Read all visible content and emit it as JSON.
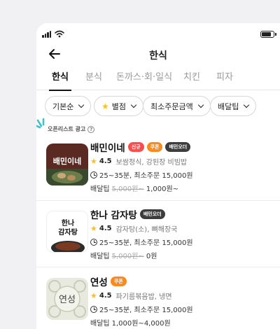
{
  "header": {
    "title": "한식"
  },
  "tabs": [
    {
      "label": "한식"
    },
    {
      "label": "분식"
    },
    {
      "label": "돈까스·회·일식"
    },
    {
      "label": "치킨"
    },
    {
      "label": "피자"
    }
  ],
  "filters": [
    {
      "label": "기본순"
    },
    {
      "label": "별점"
    },
    {
      "label": "최소주문금액"
    },
    {
      "label": "배달팁"
    }
  ],
  "ad_label": "오픈리스트 광고",
  "ad_help": "?",
  "stores": [
    {
      "name": "배민이네",
      "thumb_text": "배민이네",
      "badges": [
        "신규",
        "쿠폰",
        "배민오더"
      ],
      "rating": "4.5",
      "menu": "보쌈정식, 강된장 비빔밥",
      "time_min": "25~35분, 최소주문 15,000원",
      "tip_label": "배달팁",
      "tip_old": "5,000원~",
      "tip_new": "1,000원~"
    },
    {
      "name": "한나 감자탕",
      "thumb_line1": "한나",
      "thumb_line2": "감자탕",
      "badges": [
        "배민오더"
      ],
      "rating": "4.5",
      "menu": "감자탕(소), 뼈해장국",
      "time_min": "25~35분, 최소주문 15,000원",
      "tip_label": "배달팁",
      "tip_old": "5,000원~",
      "tip_new": "0원"
    },
    {
      "name": "연성",
      "thumb_text": "연성",
      "badges": [
        "쿠폰"
      ],
      "rating": "4.5",
      "menu": "파기름볶음밥, 냉면",
      "time_min": "25~35분, 최소주문 15,000원",
      "tip_label": "배달팁",
      "tip_range": "1,000원~4,000원"
    }
  ],
  "icons": {
    "back": "arrow-left-icon",
    "star": "star-icon",
    "clock": "clock-icon",
    "chevron": "chevron-down-icon",
    "help": "question-circle-icon"
  },
  "colors": {
    "star": "#ffc21a",
    "badge_new": "#ff4d4d",
    "badge_coupon": "#ff8a1c",
    "badge_order": "#3d3d3d",
    "sparkle": "#3ec3c8"
  }
}
